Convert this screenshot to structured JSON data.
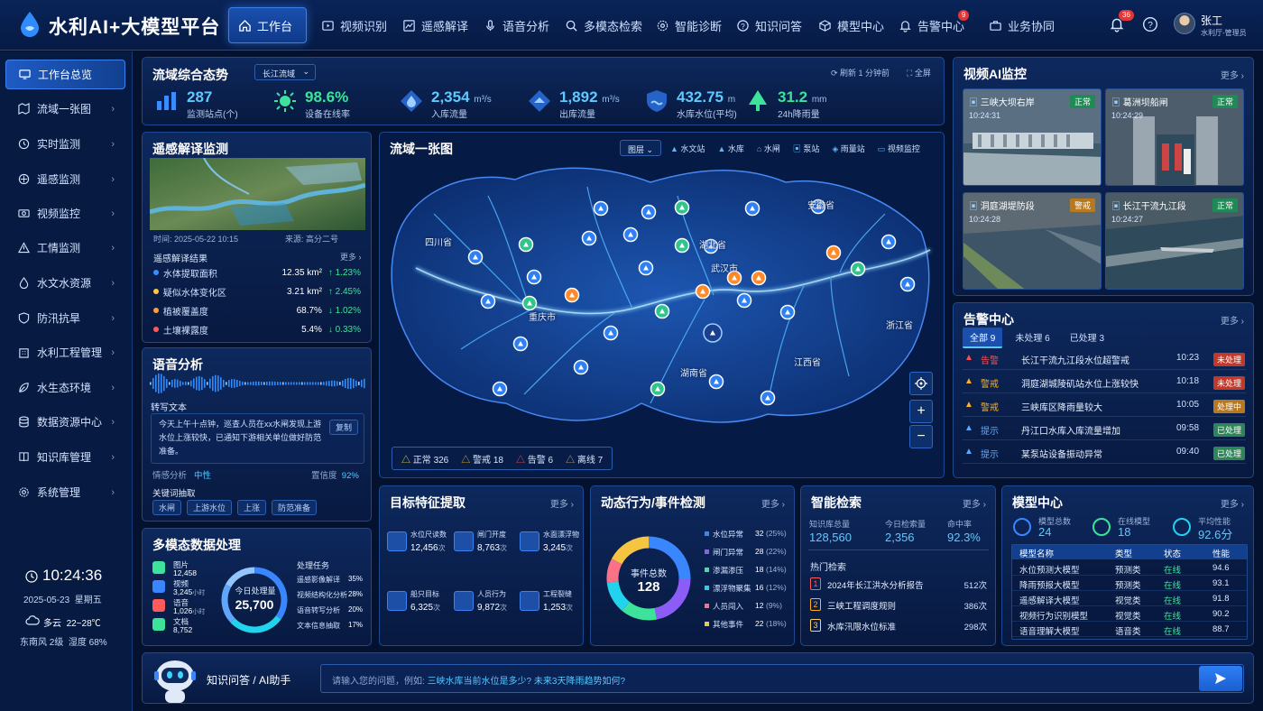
{
  "app": {
    "title": "水利AI+大模型平台"
  },
  "nav": [
    {
      "label": "工作台",
      "icon": "home-icon"
    },
    {
      "label": "视频识别",
      "icon": "video-icon"
    },
    {
      "label": "遥感解译",
      "icon": "image-icon"
    },
    {
      "label": "语音分析",
      "icon": "mic-icon"
    },
    {
      "label": "多模态检索",
      "icon": "search-icon"
    },
    {
      "label": "智能诊断",
      "icon": "gear-icon"
    },
    {
      "label": "知识问答",
      "icon": "question-icon"
    },
    {
      "label": "模型中心",
      "icon": "cube-icon"
    },
    {
      "label": "告警中心",
      "icon": "bell-icon",
      "badge": "9"
    },
    {
      "label": "业务协同",
      "icon": "briefcase-icon"
    }
  ],
  "header_right": {
    "notify_badge": "36",
    "user_name": "张工",
    "user_role": "水利厅-管理员"
  },
  "sidebar": {
    "items": [
      {
        "label": "工作台总览"
      },
      {
        "label": "流域一张图"
      },
      {
        "label": "实时监测"
      },
      {
        "label": "遥感监测"
      },
      {
        "label": "视频监控"
      },
      {
        "label": "工情监测"
      },
      {
        "label": "水文水资源"
      },
      {
        "label": "防汛抗旱"
      },
      {
        "label": "水利工程管理"
      },
      {
        "label": "水生态环境"
      },
      {
        "label": "数据资源中心"
      },
      {
        "label": "知识库管理"
      },
      {
        "label": "系统管理"
      }
    ],
    "clock": "10:24:36",
    "date": "2025-05-23",
    "weekday": "星期五",
    "weather": "多云",
    "temp": "22~28℃",
    "wind": "东南风 2级",
    "humidity": "湿度 68%"
  },
  "overview": {
    "title": "流域综合态势",
    "select": "长江流域",
    "refresh": "刷新 1 分钟前",
    "fullscreen": "全屏",
    "stats": [
      {
        "value": "287",
        "unit": "",
        "label": "监测站点(个)"
      },
      {
        "value": "98.6%",
        "unit": "",
        "label": "设备在线率"
      },
      {
        "value": "2,354",
        "unit": "m³/s",
        "label": "入库流量"
      },
      {
        "value": "1,892",
        "unit": "m³/s",
        "label": "出库流量"
      },
      {
        "value": "432.75",
        "unit": "m",
        "label": "水库水位(平均)"
      },
      {
        "value": "31.2",
        "unit": "mm",
        "label": "24h降雨量"
      }
    ]
  },
  "remote": {
    "title": "遥感解译监测",
    "time": "时间: 2025-05-22 10:15",
    "source": "来源: 高分二号",
    "subtitle": "遥感解译结果",
    "more": "更多",
    "rows": [
      {
        "name": "水体提取面积",
        "value": "12.35 km²",
        "delta": "↑ 1.23%",
        "color": "#3b8cff",
        "dir": "up"
      },
      {
        "name": "疑似水体变化区",
        "value": "3.21 km²",
        "delta": "↑ 2.45%",
        "color": "#ffc53d",
        "dir": "up"
      },
      {
        "name": "植被覆盖度",
        "value": "68.7%",
        "delta": "↓ 1.02%",
        "color": "#ff9d3d",
        "dir": "down"
      },
      {
        "name": "土壤裸露度",
        "value": "5.4%",
        "delta": "↓ 0.33%",
        "color": "#ff5a5a",
        "dir": "down"
      }
    ]
  },
  "voice": {
    "title": "语音分析",
    "transcript_label": "转写文本",
    "transcript": "今天上午十点钟，巡查人员在xx水闸发现上游水位上涨较快，已通知下游相关单位做好防范准备。",
    "copy": "复制",
    "sentiment_label": "情感分析",
    "sentiment": "中性",
    "confidence_label": "置信度",
    "confidence": "92%",
    "keywords_label": "关键词抽取",
    "keywords": [
      "水闸",
      "上游水位",
      "上涨",
      "防范准备"
    ]
  },
  "multimodal": {
    "title": "多模态数据处理",
    "items": [
      {
        "name": "图片",
        "value": "12,458",
        "unit": ""
      },
      {
        "name": "视频",
        "value": "3,245",
        "unit": "小时"
      },
      {
        "name": "语音",
        "value": "1,026",
        "unit": "小时"
      },
      {
        "name": "文档",
        "value": "8,752",
        "unit": ""
      }
    ],
    "center_label": "今日处理量",
    "center_value": "25,700",
    "tasks_title": "处理任务",
    "tasks": [
      {
        "name": "遥感影像解译",
        "pct": "35%"
      },
      {
        "name": "视频结构化分析",
        "pct": "28%"
      },
      {
        "name": "语音转写分析",
        "pct": "20%"
      },
      {
        "name": "文本信息抽取",
        "pct": "17%"
      }
    ]
  },
  "map": {
    "title": "流域一张图",
    "layer": "图层",
    "legend_types": [
      "水文站",
      "水库",
      "水闸",
      "泵站",
      "雨量站",
      "视频监控"
    ],
    "provinces": [
      "四川省",
      "湖北省",
      "安徽省",
      "重庆市",
      "湖南省",
      "江西省",
      "浙江省",
      "武汉市"
    ],
    "status": [
      {
        "name": "正常",
        "count": "326",
        "color": "#e0e048"
      },
      {
        "name": "警戒",
        "count": "18",
        "color": "#ffb020"
      },
      {
        "name": "告警",
        "count": "6",
        "color": "#ff5050"
      },
      {
        "name": "离线",
        "count": "7",
        "color": "#c9b77a"
      }
    ]
  },
  "video": {
    "title": "视频AI监控",
    "more": "更多",
    "cams": [
      {
        "name": "三峡大坝右岸",
        "time": "10:24:31",
        "status": "正常"
      },
      {
        "name": "葛洲坝船闸",
        "time": "10:24:29",
        "status": "正常"
      },
      {
        "name": "洞庭湖堤防段",
        "time": "10:24:28",
        "status": "警戒"
      },
      {
        "name": "长江干流九江段",
        "time": "10:24:27",
        "status": "正常"
      }
    ]
  },
  "alarm": {
    "title": "告警中心",
    "more": "更多",
    "tabs": [
      {
        "label": "全部",
        "count": "9"
      },
      {
        "label": "未处理",
        "count": "6"
      },
      {
        "label": "已处理",
        "count": "3"
      }
    ],
    "items": [
      {
        "level": "告警",
        "text": "长江干流九江段水位超警戒",
        "time": "10:23",
        "status": "未处理",
        "lcolor": "#ff5050",
        "scolor": "#c0392b"
      },
      {
        "level": "警戒",
        "text": "洞庭湖城陵矶站水位上涨较快",
        "time": "10:18",
        "status": "未处理",
        "lcolor": "#ffb020",
        "scolor": "#c0392b"
      },
      {
        "level": "警戒",
        "text": "三峡库区降雨量较大",
        "time": "10:05",
        "status": "处理中",
        "lcolor": "#ffb020",
        "scolor": "#b7791f"
      },
      {
        "level": "提示",
        "text": "丹江口水库入库流量增加",
        "time": "09:58",
        "status": "已处理",
        "lcolor": "#5ea8ff",
        "scolor": "#2f855a"
      },
      {
        "level": "提示",
        "text": "某泵站设备振动异常",
        "time": "09:40",
        "status": "已处理",
        "lcolor": "#5ea8ff",
        "scolor": "#2f855a"
      }
    ]
  },
  "target": {
    "title": "目标特征提取",
    "more": "更多",
    "items": [
      {
        "name": "水位尺读数",
        "value": "12,456",
        "unit": "次"
      },
      {
        "name": "闸门开度",
        "value": "8,763",
        "unit": "次"
      },
      {
        "name": "水面漂浮物",
        "value": "3,245",
        "unit": "次"
      },
      {
        "name": "船只目标",
        "value": "6,325",
        "unit": "次"
      },
      {
        "name": "人员行为",
        "value": "9,872",
        "unit": "次"
      },
      {
        "name": "工程裂缝",
        "value": "1,253",
        "unit": "次"
      }
    ]
  },
  "events": {
    "title": "动态行为/事件检测",
    "more": "更多",
    "center_label": "事件总数",
    "center_value": "128",
    "items": [
      {
        "name": "水位异常",
        "count": "32",
        "pct": "(25%)",
        "color": "#3a86ff"
      },
      {
        "name": "闸门异常",
        "count": "28",
        "pct": "(22%)",
        "color": "#8b5cf6"
      },
      {
        "name": "渗漏渗压",
        "count": "18",
        "pct": "(14%)",
        "color": "#3de39b"
      },
      {
        "name": "漂浮物聚集",
        "count": "16",
        "pct": "(12%)",
        "color": "#22d3ee"
      },
      {
        "name": "人员闯入",
        "count": "12",
        "pct": "(9%)",
        "color": "#fb7185"
      },
      {
        "name": "其他事件",
        "count": "22",
        "pct": "(18%)",
        "color": "#f5c542"
      }
    ]
  },
  "search": {
    "title": "智能检索",
    "more": "更多",
    "stats": [
      {
        "label": "知识库总量",
        "value": "128,560"
      },
      {
        "label": "今日检索量",
        "value": "2,356"
      },
      {
        "label": "命中率",
        "value": "92.3%"
      }
    ],
    "hot_title": "热门检索",
    "hot": [
      {
        "rank": "1",
        "text": "2024年长江洪水分析报告",
        "count": "512次"
      },
      {
        "rank": "2",
        "text": "三峡工程调度规则",
        "count": "386次"
      },
      {
        "rank": "3",
        "text": "水库汛限水位标准",
        "count": "298次"
      }
    ]
  },
  "models": {
    "title": "模型中心",
    "more": "更多",
    "stats": [
      {
        "label": "模型总数",
        "value": "24"
      },
      {
        "label": "在线模型",
        "value": "18"
      },
      {
        "label": "平均性能",
        "value": "92.6分"
      }
    ],
    "headers": [
      "模型名称",
      "类型",
      "状态",
      "性能"
    ],
    "rows": [
      {
        "name": "水位预测大模型",
        "type": "预测类",
        "status": "在线",
        "score": "94.6"
      },
      {
        "name": "降雨预报大模型",
        "type": "预测类",
        "status": "在线",
        "score": "93.1"
      },
      {
        "name": "遥感解译大模型",
        "type": "视觉类",
        "status": "在线",
        "score": "91.8"
      },
      {
        "name": "视频行为识别模型",
        "type": "视觉类",
        "status": "在线",
        "score": "90.2"
      },
      {
        "name": "语音理解大模型",
        "type": "语音类",
        "status": "在线",
        "score": "88.7"
      }
    ]
  },
  "qa": {
    "label": "知识问答 / AI助手",
    "placeholder_prefix": "请输入您的问题，例如:",
    "placeholder_example": "三峡水库当前水位是多少? 未来3天降雨趋势如何?"
  }
}
